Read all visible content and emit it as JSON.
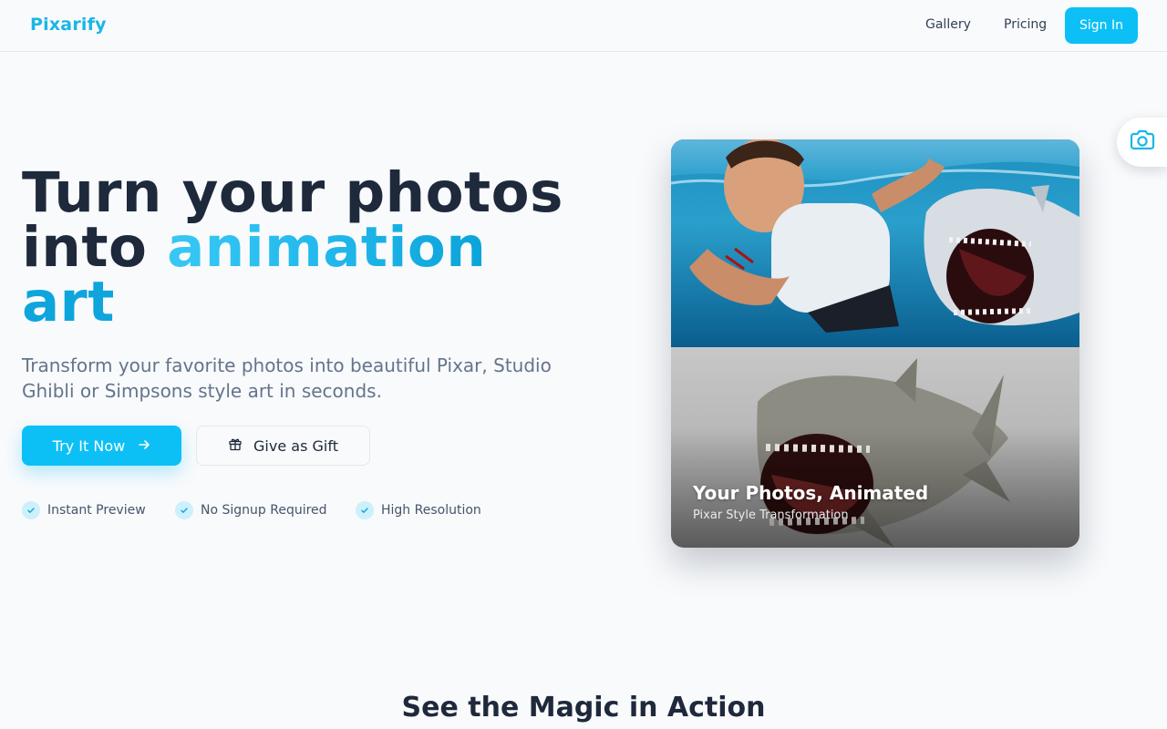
{
  "header": {
    "brand": "Pixarify",
    "nav": [
      {
        "label": "Gallery"
      },
      {
        "label": "Pricing"
      }
    ],
    "signin_label": "Sign In"
  },
  "hero": {
    "title_line1": "Turn your photos",
    "title_line2_plain": "into ",
    "title_line2_accent": "animation",
    "title_line3": "art",
    "subtitle": "Transform your favorite photos into beautiful Pixar, Studio Ghibli or Simpsons style art in seconds.",
    "try_label": "Try It Now",
    "gift_label": "Give as Gift",
    "features": [
      {
        "label": "Instant Preview"
      },
      {
        "label": "No Signup Required"
      },
      {
        "label": "High Resolution"
      }
    ]
  },
  "preview_card": {
    "title": "Your Photos, Animated",
    "subtitle": "Pixar Style Transformation"
  },
  "section": {
    "title": "See the Magic in Action"
  },
  "colors": {
    "accent": "#0cc0f5",
    "brand": "#19b6e6",
    "text": "#1e293b",
    "muted": "#64748b"
  },
  "icons": {
    "try": "arrow-right-icon",
    "gift": "gift-icon",
    "feature": "check-icon",
    "fab": "camera-icon"
  }
}
